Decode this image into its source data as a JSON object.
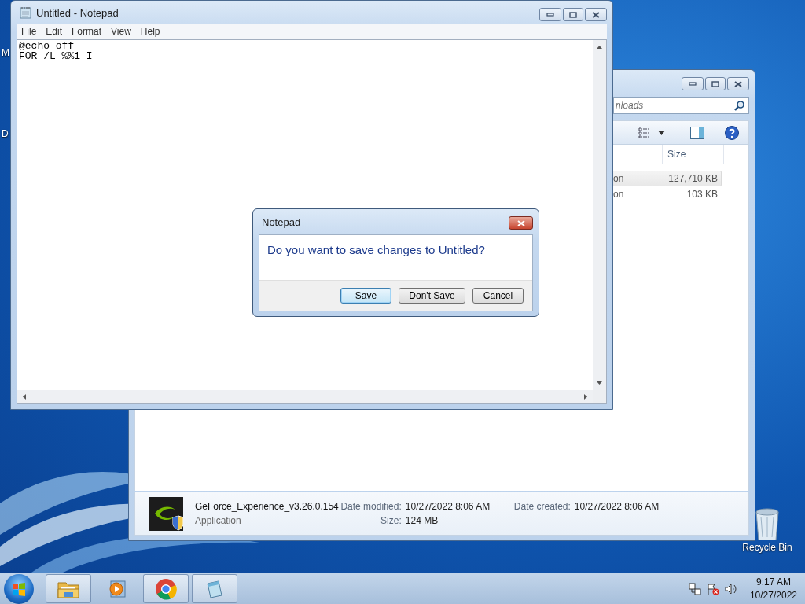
{
  "desktop": {
    "icon_labels": [
      "M",
      "D"
    ],
    "recycle_bin_label": "Recycle Bin"
  },
  "explorer": {
    "search_placeholder": "nloads",
    "size_column": "Size",
    "rows": [
      {
        "column_1": "on",
        "size": "127,710 KB",
        "selected": true
      },
      {
        "column_1": "on",
        "size": "103 KB",
        "selected": false
      }
    ],
    "details": {
      "file_name": "GeForce_Experience_v3.26.0.154",
      "file_type": "Application",
      "date_modified_label": "Date modified:",
      "date_modified": "10/27/2022 8:06 AM",
      "size_label": "Size:",
      "size": "124 MB",
      "date_created_label": "Date created:",
      "date_created": "10/27/2022 8:06 AM"
    }
  },
  "notepad": {
    "title": "Untitled - Notepad",
    "menu": [
      "File",
      "Edit",
      "Format",
      "View",
      "Help"
    ],
    "text_lines": [
      "@echo off",
      "FOR /L %%i I"
    ]
  },
  "dialog": {
    "title": "Notepad",
    "message": "Do you want to save changes to Untitled?",
    "buttons": [
      {
        "label": "Save",
        "focused": true
      },
      {
        "label": "Don't Save",
        "focused": false
      },
      {
        "label": "Cancel",
        "focused": false
      }
    ]
  },
  "taskbar": {
    "apps": [
      {
        "kind": "file-explorer",
        "running": true
      },
      {
        "kind": "media-player",
        "running": false
      },
      {
        "kind": "browser",
        "running": true
      },
      {
        "kind": "notepad",
        "running": true
      }
    ],
    "clock": {
      "time": "9:17 AM",
      "date": "10/27/2022"
    }
  }
}
